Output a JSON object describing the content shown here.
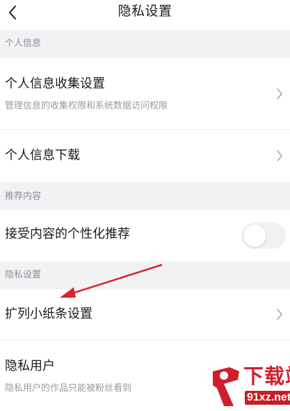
{
  "header": {
    "title": "隐私设置",
    "back_icon": "chevron-left-icon"
  },
  "sections": [
    {
      "label": "个人信息",
      "rows": [
        {
          "title": "个人信息收集设置",
          "subtitle": "管理信息的收集权限和系统数据访问权限",
          "control": "chevron-right-icon"
        },
        {
          "title": "个人信息下载",
          "control": "chevron-right-icon"
        }
      ]
    },
    {
      "label": "推荐内容",
      "rows": [
        {
          "title": "接受内容的个性化推荐",
          "control": "toggle",
          "toggle_on": false
        }
      ]
    },
    {
      "label": "隐私设置",
      "rows": [
        {
          "title": "扩列小纸条设置",
          "control": "chevron-right-icon"
        },
        {
          "title": "隐私用户",
          "subtitle": "隐私用户的作品只能被粉丝看到"
        }
      ]
    }
  ],
  "watermark": {
    "logo_text": "9",
    "name": "下载站",
    "url": "91xz.net"
  },
  "colors": {
    "section_bg": "#f2f2f5",
    "section_text": "#8e8e95",
    "title_text": "#1b1b1f",
    "subtitle_text": "#9a9aa2",
    "annotation_arrow": "#d7262b",
    "watermark_red": "#cf1f2a"
  }
}
